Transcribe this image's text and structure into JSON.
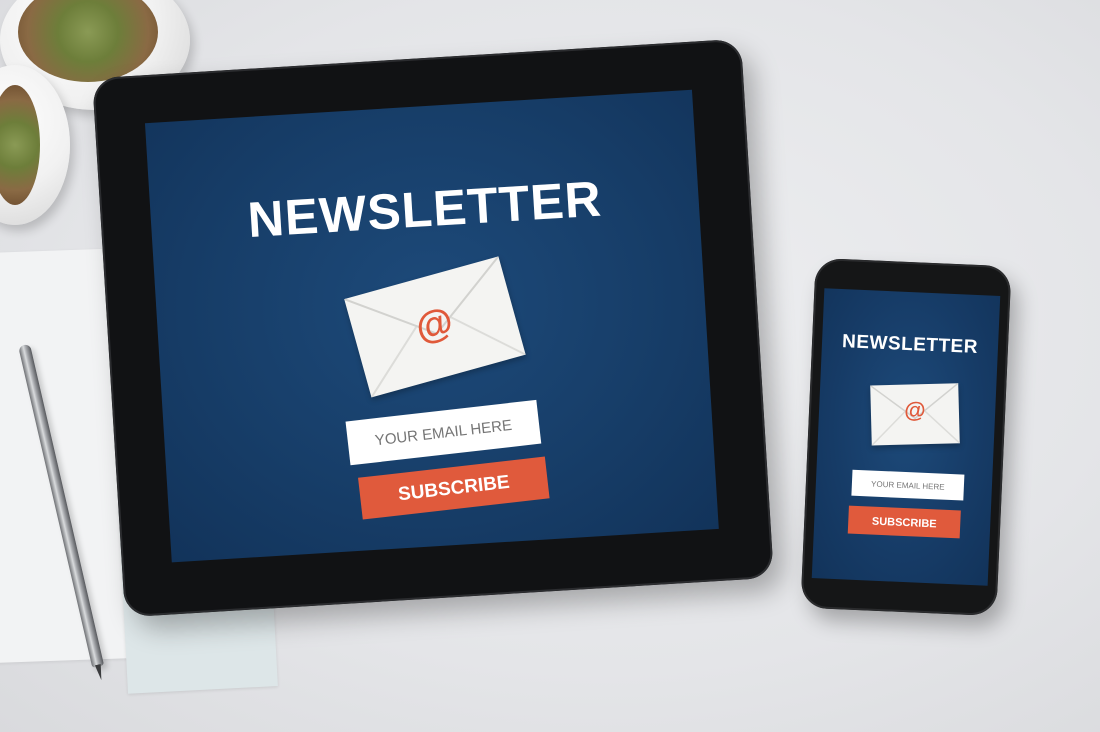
{
  "scene": {
    "background_color": "#e6e7e9",
    "accent_color": "#e05a3c",
    "screen_color": "#173e69"
  },
  "tablet": {
    "title": "NEWSLETTER",
    "icon": "envelope-at-icon",
    "at_symbol": "@",
    "email_placeholder": "YOUR EMAIL HERE",
    "subscribe_label": "SUBSCRIBE"
  },
  "phone": {
    "title": "NEWSLETTER",
    "icon": "envelope-at-icon",
    "at_symbol": "@",
    "email_placeholder": "YOUR EMAIL HERE",
    "subscribe_label": "SUBSCRIBE"
  }
}
